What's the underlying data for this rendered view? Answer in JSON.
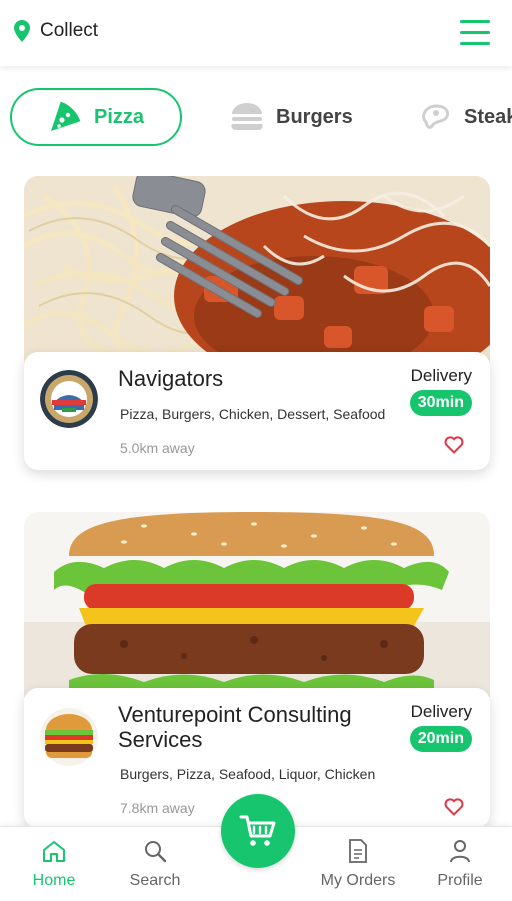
{
  "header": {
    "location_label": "Collect",
    "location_icon": "map-pin-icon",
    "menu_icon": "hamburger-menu-icon",
    "accent_color": "#17c56f"
  },
  "categories": [
    {
      "label": "Pizza",
      "icon": "pizza-icon",
      "active": true
    },
    {
      "label": "Burgers",
      "icon": "burger-icon",
      "active": false
    },
    {
      "label": "Steak",
      "icon": "steak-icon",
      "active": false
    }
  ],
  "restaurants": [
    {
      "name": "Navigators",
      "cuisines": "Pizza, Burgers, Chicken, Dessert, Seafood",
      "distance": "5.0km away",
      "delivery_label": "Delivery",
      "eta": "30min",
      "image": "pasta-photo",
      "logo": "navigators-logo"
    },
    {
      "name": "Venturepoint Consulting Services",
      "cuisines": "Burgers, Pizza, Seafood, Liquor, Chicken",
      "distance": "7.8km away",
      "delivery_label": "Delivery",
      "eta": "20min",
      "image": "burger-photo",
      "logo": "burger-logo"
    }
  ],
  "bottom_nav": {
    "items": [
      {
        "label": "Home",
        "icon": "home-icon",
        "active": true
      },
      {
        "label": "Search",
        "icon": "search-icon",
        "active": false
      },
      {
        "label": "My Orders",
        "icon": "document-icon",
        "active": false
      },
      {
        "label": "Profile",
        "icon": "user-icon",
        "active": false
      }
    ],
    "center_icon": "cart-icon"
  }
}
